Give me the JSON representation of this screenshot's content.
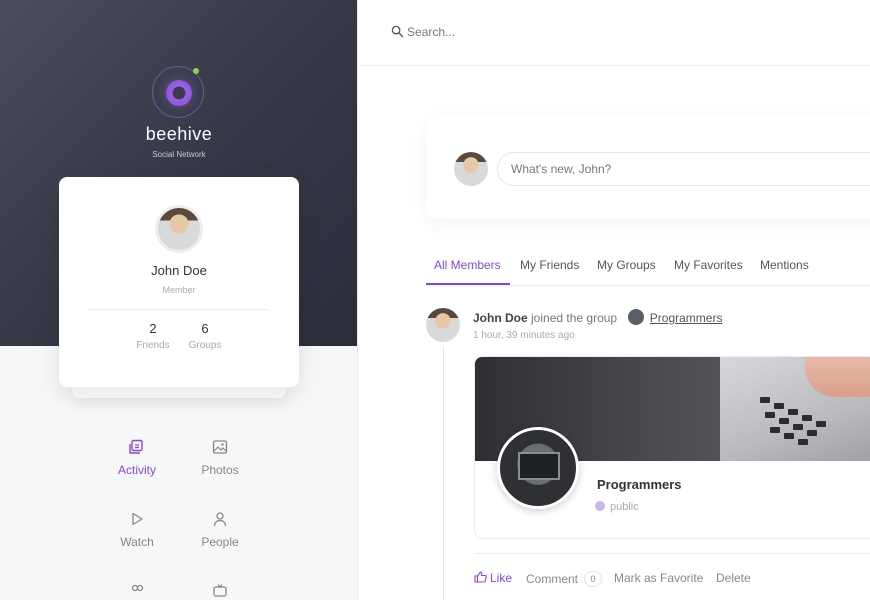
{
  "brand": {
    "name": "beehive",
    "tagline": "Social Network"
  },
  "profile": {
    "name": "John Doe",
    "role": "Member",
    "stats": [
      {
        "value": "2",
        "label": "Friends"
      },
      {
        "value": "6",
        "label": "Groups"
      }
    ]
  },
  "nav": [
    {
      "label": "Activity",
      "icon": "activity-icon",
      "active": true
    },
    {
      "label": "Photos",
      "icon": "photos-icon"
    },
    {
      "label": "Watch",
      "icon": "watch-icon"
    },
    {
      "label": "People",
      "icon": "people-icon"
    },
    {
      "label": "",
      "icon": "groups-icon"
    },
    {
      "label": "",
      "icon": "tv-icon"
    }
  ],
  "search": {
    "placeholder": "Search..."
  },
  "composer": {
    "placeholder": "What's new, John?"
  },
  "tabs": [
    "All Members",
    "My Friends",
    "My Groups",
    "My Favorites",
    "Mentions"
  ],
  "post": {
    "author": "John Doe",
    "action": "joined the group",
    "group": "Programmers",
    "time": "1 hour, 39 minutes ago",
    "card": {
      "name": "Programmers",
      "privacy": "public"
    },
    "actions": {
      "like": "Like",
      "comment": "Comment",
      "comment_count": "0",
      "favorite": "Mark as Favorite",
      "delete": "Delete"
    }
  },
  "colors": {
    "accent": "#8a46d9",
    "sidebar_dark": "#343746"
  }
}
